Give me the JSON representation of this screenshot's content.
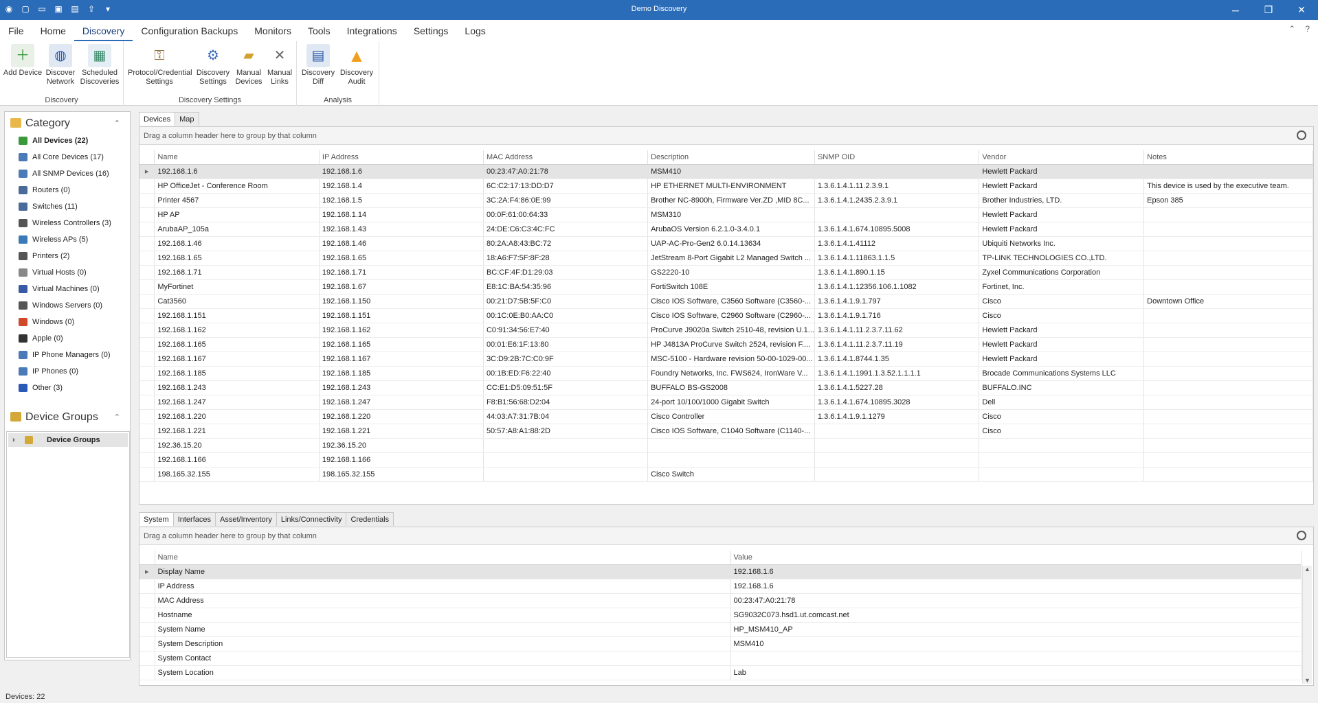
{
  "app": {
    "title": "Demo Discovery"
  },
  "menu": [
    "File",
    "Home",
    "Discovery",
    "Configuration Backups",
    "Monitors",
    "Tools",
    "Integrations",
    "Settings",
    "Logs"
  ],
  "ribbon": {
    "discovery": {
      "label": "Discovery",
      "add_device": "Add Device",
      "discover_network": [
        "Discover",
        "Network"
      ],
      "scheduled": [
        "Scheduled",
        "Discoveries"
      ]
    },
    "settings": {
      "label": "Discovery Settings",
      "protocol": [
        "Protocol/Credential",
        "Settings"
      ],
      "discovery": [
        "Discovery",
        "Settings"
      ],
      "manual_devices": [
        "Manual",
        "Devices"
      ],
      "manual_links": [
        "Manual",
        "Links"
      ]
    },
    "analysis": {
      "label": "Analysis",
      "diff": [
        "Discovery",
        "Diff"
      ],
      "audit": [
        "Discovery",
        "Audit"
      ]
    }
  },
  "sidebar": {
    "category_title": "Category",
    "items": [
      {
        "label": "All Devices (22)",
        "color": "#3a9a3a",
        "bold": true
      },
      {
        "label": "All Core Devices (17)",
        "color": "#4a7ab8"
      },
      {
        "label": "All SNMP Devices (16)",
        "color": "#4a7ab8"
      },
      {
        "label": "Routers (0)",
        "color": "#4a6a9a"
      },
      {
        "label": "Switches (11)",
        "color": "#4a6a9a"
      },
      {
        "label": "Wireless Controllers (3)",
        "color": "#555555"
      },
      {
        "label": "Wireless APs (5)",
        "color": "#3a7ab8"
      },
      {
        "label": "Printers (2)",
        "color": "#555555"
      },
      {
        "label": "Virtual Hosts (0)",
        "color": "#888888"
      },
      {
        "label": "Virtual Machines (0)",
        "color": "#3a5aa8"
      },
      {
        "label": "Windows Servers (0)",
        "color": "#555555"
      },
      {
        "label": "Windows (0)",
        "color": "#d04a2a"
      },
      {
        "label": "Apple (0)",
        "color": "#333333"
      },
      {
        "label": "IP Phone Managers (0)",
        "color": "#4a7ab8"
      },
      {
        "label": "IP Phones (0)",
        "color": "#4a7ab8"
      },
      {
        "label": "Other (3)",
        "color": "#2a5ab8"
      }
    ],
    "groups_title": "Device Groups",
    "group_item": "Device Groups"
  },
  "devices": {
    "tabs": [
      "Devices",
      "Map"
    ],
    "group_hint": "Drag a column header here to group by that column",
    "columns": [
      "Name",
      "IP Address",
      "MAC Address",
      "Description",
      "SNMP OID",
      "Vendor",
      "Notes"
    ],
    "rows": [
      [
        "192.168.1.6",
        "192.168.1.6",
        "00:23:47:A0:21:78",
        "MSM410",
        "",
        "Hewlett Packard",
        ""
      ],
      [
        "HP OfficeJet - Conference Room",
        "192.168.1.4",
        "6C:C2:17:13:DD:D7",
        "HP ETHERNET MULTI-ENVIRONMENT",
        "1.3.6.1.4.1.11.2.3.9.1",
        "Hewlett Packard",
        "This device is used by the executive team."
      ],
      [
        "Printer 4567",
        "192.168.1.5",
        "3C:2A:F4:86:0E:99",
        "Brother NC-8900h, Firmware Ver.ZD ,MID 8C...",
        "1.3.6.1.4.1.2435.2.3.9.1",
        "Brother Industries, LTD.",
        "Epson 385"
      ],
      [
        "HP AP",
        "192.168.1.14",
        "00:0F:61:00:64:33",
        "MSM310",
        "",
        "Hewlett Packard",
        ""
      ],
      [
        "ArubaAP_105a",
        "192.168.1.43",
        "24:DE:C6:C3:4C:FC",
        "ArubaOS Version 6.2.1.0-3.4.0.1",
        "1.3.6.1.4.1.674.10895.5008",
        "Hewlett Packard",
        ""
      ],
      [
        "192.168.1.46",
        "192.168.1.46",
        "80:2A:A8:43:BC:72",
        "UAP-AC-Pro-Gen2 6.0.14.13634",
        "1.3.6.1.4.1.41112",
        "Ubiquiti Networks Inc.",
        ""
      ],
      [
        "192.168.1.65",
        "192.168.1.65",
        "18:A6:F7:5F:8F:28",
        "JetStream 8-Port Gigabit L2 Managed Switch ...",
        "1.3.6.1.4.1.11863.1.1.5",
        "TP-LINK TECHNOLOGIES CO.,LTD.",
        ""
      ],
      [
        "192.168.1.71",
        "192.168.1.71",
        "BC:CF:4F:D1:29:03",
        "GS2220-10",
        "1.3.6.1.4.1.890.1.15",
        "Zyxel Communications Corporation",
        ""
      ],
      [
        "MyFortinet",
        "192.168.1.67",
        "E8:1C:BA:54:35:96",
        "FortiSwitch 108E",
        "1.3.6.1.4.1.12356.106.1.1082",
        "Fortinet, Inc.",
        ""
      ],
      [
        "Cat3560",
        "192.168.1.150",
        "00:21:D7:5B:5F:C0",
        "Cisco IOS Software, C3560 Software (C3560-...",
        "1.3.6.1.4.1.9.1.797",
        "Cisco",
        "Downtown Office"
      ],
      [
        "192.168.1.151",
        "192.168.1.151",
        "00:1C:0E:B0:AA:C0",
        "Cisco IOS Software, C2960 Software (C2960-...",
        "1.3.6.1.4.1.9.1.716",
        "Cisco",
        ""
      ],
      [
        "192.168.1.162",
        "192.168.1.162",
        "C0:91:34:56:E7:40",
        "ProCurve J9020a Switch 2510-48, revision U.1...",
        "1.3.6.1.4.1.11.2.3.7.11.62",
        "Hewlett Packard",
        ""
      ],
      [
        "192.168.1.165",
        "192.168.1.165",
        "00:01:E6:1F:13:80",
        "HP J4813A ProCurve Switch 2524, revision F....",
        "1.3.6.1.4.1.11.2.3.7.11.19",
        "Hewlett Packard",
        ""
      ],
      [
        "192.168.1.167",
        "192.168.1.167",
        "3C:D9:2B:7C:C0:9F",
        "MSC-5100 - Hardware revision 50-00-1029-00...",
        "1.3.6.1.4.1.8744.1.35",
        "Hewlett Packard",
        ""
      ],
      [
        "192.168.1.185",
        "192.168.1.185",
        "00:1B:ED:F6:22:40",
        "Foundry Networks, Inc. FWS624, IronWare V...",
        "1.3.6.1.4.1.1991.1.3.52.1.1.1.1",
        "Brocade Communications Systems LLC",
        ""
      ],
      [
        "192.168.1.243",
        "192.168.1.243",
        "CC:E1:D5:09:51:5F",
        "BUFFALO BS-GS2008",
        "1.3.6.1.4.1.5227.28",
        "BUFFALO.INC",
        ""
      ],
      [
        "192.168.1.247",
        "192.168.1.247",
        "F8:B1:56:68:D2:04",
        "24-port 10/100/1000 Gigabit Switch",
        "1.3.6.1.4.1.674.10895.3028",
        "Dell",
        ""
      ],
      [
        "192.168.1.220",
        "192.168.1.220",
        "44:03:A7:31:7B:04",
        "Cisco Controller",
        "1.3.6.1.4.1.9.1.1279",
        "Cisco",
        ""
      ],
      [
        "192.168.1.221",
        "192.168.1.221",
        "50:57:A8:A1:88:2D",
        "Cisco IOS Software, C1040 Software (C1140-...",
        "",
        "Cisco",
        ""
      ],
      [
        "192.36.15.20",
        "192.36.15.20",
        "",
        "",
        "",
        "",
        ""
      ],
      [
        "192.168.1.166",
        "192.168.1.166",
        "",
        "",
        "",
        "",
        ""
      ],
      [
        "198.165.32.155",
        "198.165.32.155",
        "",
        "Cisco Switch",
        "",
        "",
        ""
      ]
    ]
  },
  "details": {
    "tabs": [
      "System",
      "Interfaces",
      "Asset/Inventory",
      "Links/Connectivity",
      "Credentials"
    ],
    "group_hint": "Drag a column header here to group by that column",
    "columns": [
      "Name",
      "Value"
    ],
    "rows": [
      [
        "Display Name",
        "192.168.1.6"
      ],
      [
        "IP Address",
        "192.168.1.6"
      ],
      [
        "MAC Address",
        "00:23:47:A0:21:78"
      ],
      [
        "Hostname",
        "SG9032C073.hsd1.ut.comcast.net"
      ],
      [
        "System Name",
        "HP_MSM410_AP"
      ],
      [
        "System Description",
        "MSM410"
      ],
      [
        "System Contact",
        ""
      ],
      [
        "System Location",
        "Lab"
      ]
    ]
  },
  "status": {
    "text": "Devices: 22"
  }
}
